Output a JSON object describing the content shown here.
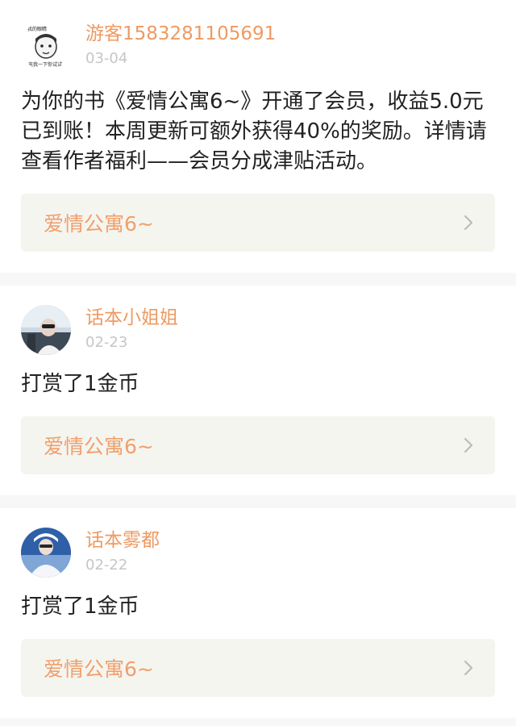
{
  "notifications": [
    {
      "user": "游客1583281105691",
      "date": "03-04",
      "avatar": "meme-avatar",
      "avatar_text": [
        "我的眼睛",
        "充我一下你试试"
      ],
      "message": "为你的书《爱情公寓6~》开通了会员，收益5.0元已到账！本周更新可额外获得40%的奖励。详情请查看作者福利——会员分成津贴活动。",
      "book_title": "爱情公寓6~",
      "chevron": "chevron-right-icon"
    },
    {
      "user": "话本小姐姐",
      "date": "02-23",
      "avatar": "photo-avatar",
      "message": "打赏了1金币",
      "book_title": "爱情公寓6~",
      "chevron": "chevron-right-icon"
    },
    {
      "user": "话本雾都",
      "date": "02-22",
      "avatar": "photo-avatar",
      "message": "打赏了1金币",
      "book_title": "爱情公寓6~",
      "chevron": "chevron-right-icon"
    }
  ],
  "colors": {
    "accent": "#ee9a62",
    "date": "#c6c6c6",
    "text": "#222222",
    "card_link_bg": "#f5f5f0"
  }
}
